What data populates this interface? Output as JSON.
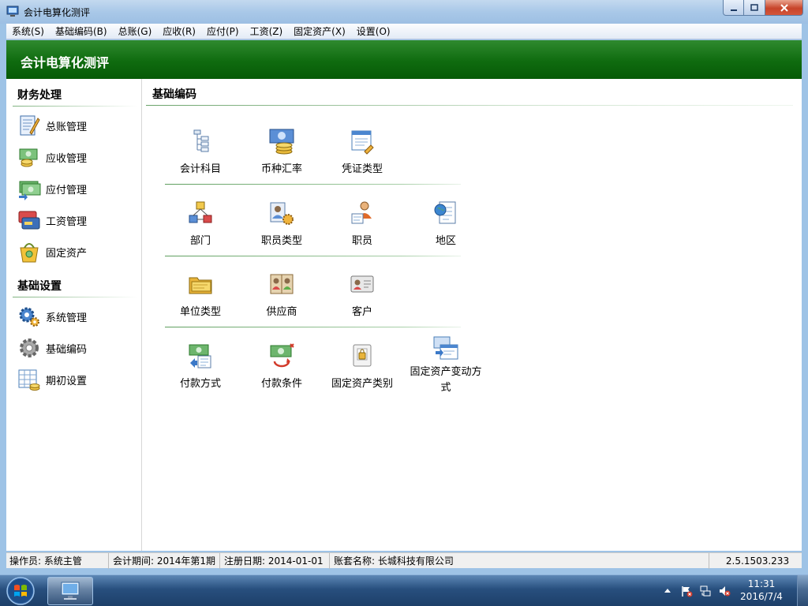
{
  "window": {
    "title": "会计电算化测评"
  },
  "menu": [
    "系统(S)",
    "基础编码(B)",
    "总账(G)",
    "应收(R)",
    "应付(P)",
    "工资(Z)",
    "固定资产(X)",
    "设置(O)"
  ],
  "banner": {
    "title": "会计电算化测评"
  },
  "sidebar": {
    "sections": [
      {
        "title": "财务处理",
        "items": [
          {
            "label": "总账管理",
            "icon": "ledger-icon"
          },
          {
            "label": "应收管理",
            "icon": "receivable-icon"
          },
          {
            "label": "应付管理",
            "icon": "payable-icon"
          },
          {
            "label": "工资管理",
            "icon": "payroll-icon"
          },
          {
            "label": "固定资产",
            "icon": "fixed-asset-icon"
          }
        ]
      },
      {
        "title": "基础设置",
        "items": [
          {
            "label": "系统管理",
            "icon": "system-gears-icon"
          },
          {
            "label": "基础编码",
            "icon": "gear-icon"
          },
          {
            "label": "期初设置",
            "icon": "opening-table-icon"
          }
        ]
      }
    ]
  },
  "main": {
    "title": "基础编码",
    "rows": [
      [
        {
          "label": "会计科目",
          "icon": "tree-icon"
        },
        {
          "label": "币种汇率",
          "icon": "currency-icon"
        },
        {
          "label": "凭证类型",
          "icon": "voucher-icon"
        }
      ],
      [
        {
          "label": "部门",
          "icon": "department-icon"
        },
        {
          "label": "职员类型",
          "icon": "staff-type-icon"
        },
        {
          "label": "职员",
          "icon": "staff-icon"
        },
        {
          "label": "地区",
          "icon": "region-icon"
        }
      ],
      [
        {
          "label": "单位类型",
          "icon": "folder-icon"
        },
        {
          "label": "供应商",
          "icon": "supplier-icon"
        },
        {
          "label": "客户",
          "icon": "customer-icon"
        }
      ],
      [
        {
          "label": "付款方式",
          "icon": "payment-method-icon"
        },
        {
          "label": "付款条件",
          "icon": "payment-terms-icon"
        },
        {
          "label": "固定资产类别",
          "icon": "asset-category-icon"
        },
        {
          "label": "固定资产变动方式",
          "icon": "asset-change-icon"
        }
      ]
    ]
  },
  "status": {
    "operator": "操作员: 系统主管",
    "period": "会计期间: 2014年第1期",
    "reg_date": "注册日期: 2014-01-01",
    "account": "账套名称: 长城科技有限公司",
    "version": "2.5.1503.233"
  },
  "taskbar": {
    "time": "11:31",
    "date": "2016/7/4"
  }
}
